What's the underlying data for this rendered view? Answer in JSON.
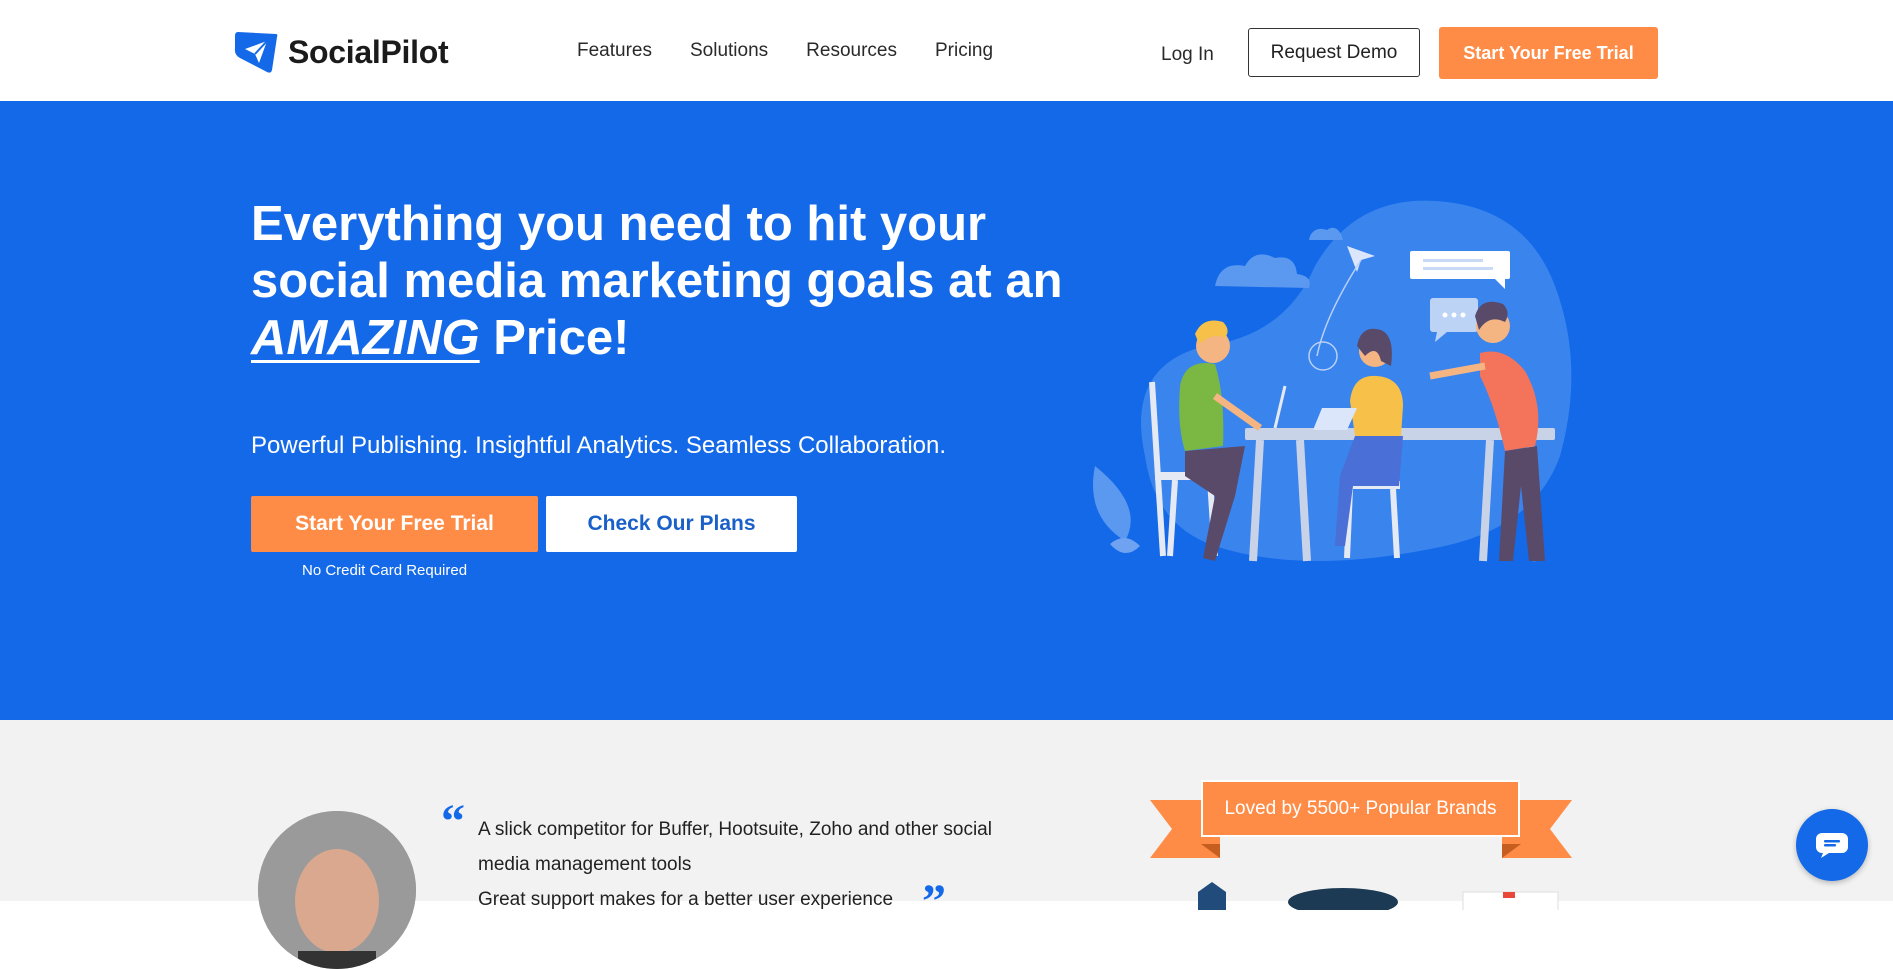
{
  "header": {
    "brand": "SocialPilot",
    "nav": [
      "Features",
      "Solutions",
      "Resources",
      "Pricing"
    ],
    "login": "Log In",
    "demo": "Request Demo",
    "trial": "Start Your Free Trial"
  },
  "hero": {
    "headline_line1": "Everything you need to hit your",
    "headline_line2": "social media marketing goals at an",
    "headline_amazing": "AMAZING",
    "headline_end": " Price!",
    "subtitle": "Powerful Publishing. Insightful Analytics. Seamless Collaboration.",
    "trial_button": "Start Your Free Trial",
    "plans_button": "Check Our Plans",
    "note": "No Credit Card Required"
  },
  "testimonial": {
    "line1": "A slick competitor for Buffer, Hootsuite, Zoho and other social",
    "line2": "media management tools",
    "line3": "Great support makes for a better user experience"
  },
  "brands": {
    "ribbon": "Loved by 5500+ Popular Brands"
  },
  "colors": {
    "primary": "#1369e8",
    "accent": "#ff8c46"
  },
  "icons": {
    "logo": "paper-plane-icon",
    "chat": "chat-bubble-icon"
  }
}
